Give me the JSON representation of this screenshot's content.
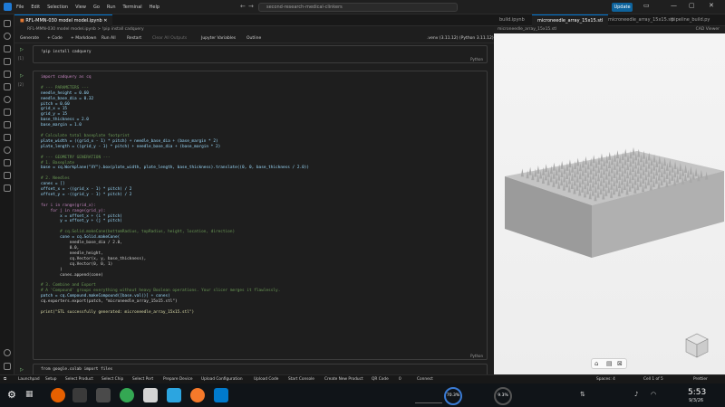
{
  "titlebar": {
    "menu": [
      "File",
      "Edit",
      "Selection",
      "View",
      "Go",
      "Run",
      "Terminal",
      "Help"
    ],
    "search": "second-research-medical-clinkers",
    "update_label": "Update"
  },
  "tabs": {
    "active": "RFL-MMN-030 model model.ipynb",
    "right": [
      "build.ipynb",
      "microneedle_array_15x15.stl",
      "microneedle_array_15x15.stl",
      "pipeline_build.py"
    ]
  },
  "breadcrumb": "RFL-MMN-030 model model.ipynb > !pip install cadquery",
  "toolbar": {
    "generate": "Generate",
    "code": "+ Code",
    "markdown": "+ Markdown",
    "run_all": "Run All",
    "restart": "Restart",
    "clear": "Clear All Outputs",
    "jupyter_vars": "Jupyter Variables",
    "outline": "Outline",
    "kernel": ".venv (3.11.12) (Python 3.11.12)"
  },
  "cells": {
    "cell1_code": "!pip install cadquery",
    "lang": "Python",
    "cell3_code": "from google.colab import files"
  },
  "code_lines": [
    "import cadquery as cq",
    "",
    "# --- PARAMETERS ---",
    "needle_height = 0.60",
    "needle_base_dia = 0.32",
    "pitch = 0.60",
    "grid_x = 15",
    "grid_y = 15",
    "base_thickness = 2.0",
    "base_margin = 1.0",
    "",
    "# Calculate total baseplate footprint",
    "plate_width = ((grid_x - 1) * pitch) + needle_base_dia + (base_margin * 2)",
    "plate_length = ((grid_y - 1) * pitch) + needle_base_dia + (base_margin * 2)",
    "",
    "# --- GEOMETRY GENERATION ---",
    "# 1. Baseplate",
    "base = cq.Workplane(\"XY\").box(plate_width, plate_length, base_thickness).translate((0, 0, base_thickness / 2.0))",
    "",
    "# 2. Needles",
    "cones = []",
    "offset_x = -((grid_x - 1) * pitch) / 2",
    "offset_y = -((grid_y - 1) * pitch) / 2",
    "",
    "for i in range(grid_x):",
    "    for j in range(grid_y):",
    "        x = offset_x + (i * pitch)",
    "        y = offset_y + (j * pitch)",
    "",
    "        # cq.Solid.makeCone(bottomRadius, topRadius, height, location, direction)",
    "        cone = cq.Solid.makeCone(",
    "            needle_base_dia / 2.0,",
    "            0.0,",
    "            needle_height,",
    "            cq.Vector(x, y, base_thickness),",
    "            cq.Vector(0, 0, 1)",
    "        )",
    "        cones.append(cone)",
    "",
    "# 3. Combine and Export",
    "# A 'Compound' groups everything without heavy Boolean operations. Your slicer merges it flawlessly.",
    "patch = cq.Compound.makeCompound([base.val()] + cones)",
    "cq.exporters.export(patch, \"microneedle_array_15x15.stl\")",
    "",
    "print(\"STL successfully generated: microneedle_array_15x15.stl\")"
  ],
  "right_pane": {
    "path": "microneedle_array_15x15.stl",
    "view_label": "CAD Viewer"
  },
  "statusbar": {
    "left": [
      "Launchpad",
      "Setup",
      "Select Product",
      "Select Chip",
      "Select Port",
      "Prepare Device",
      "Upload Configuration",
      "Upload Code",
      "Start Console",
      "Create New Product",
      "QR Code",
      "0",
      "Connect"
    ],
    "right": [
      "Spaces: 4",
      "Cell 1 of 5",
      "Prettier"
    ]
  },
  "taskbar": {
    "cpu": "70.3%",
    "mem": "9.3%",
    "time": "5:53",
    "date": "9/3/26"
  },
  "colors": {
    "accent": "#0078d4",
    "update_button": "#0e639c",
    "viewer_bg": "#f0f0f0"
  }
}
